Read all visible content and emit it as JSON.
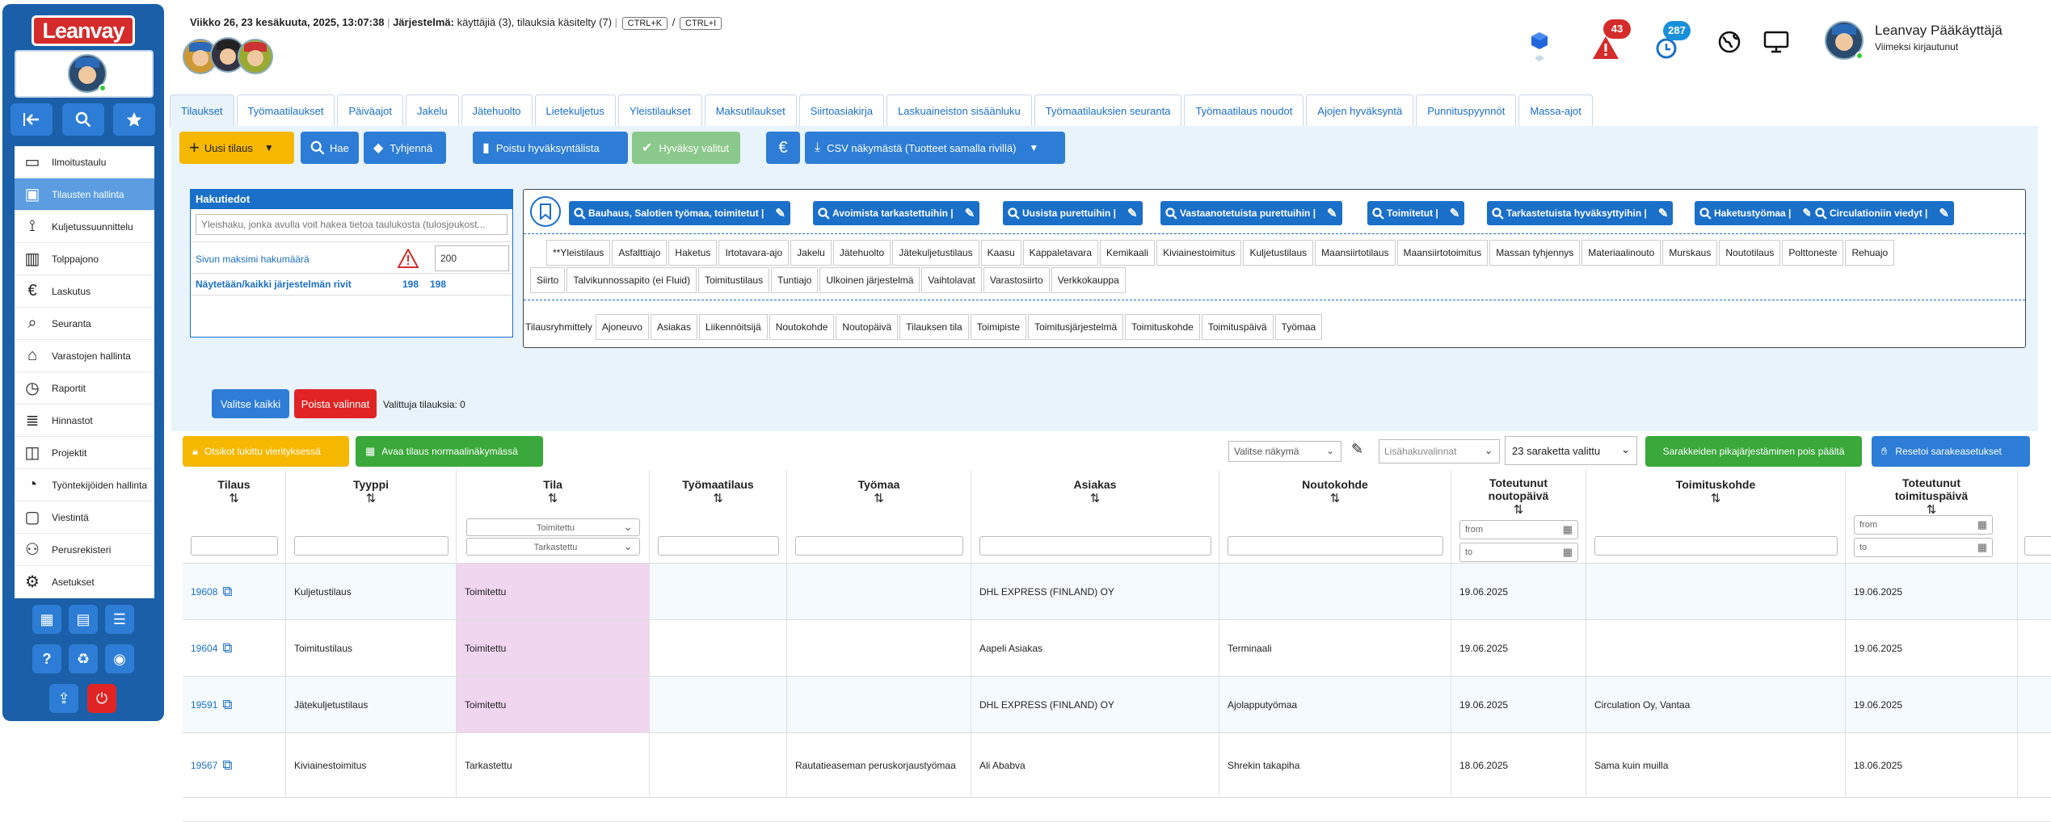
{
  "app": {
    "logo": "Leanvay"
  },
  "header": {
    "date": "Viikko 26, 23 kesäkuuta, 2025, 13:07:38",
    "sys_label": "Järjestelmä:",
    "sys_value": "käyttäjiä (3), tilauksia käsitelty (7)",
    "kbd1": "CTRL+K",
    "sep": "/",
    "kbd2": "CTRL+I",
    "badge_alerts": "43",
    "badge_clock": "287",
    "user_name": "Leanvay Pääkäyttäjä",
    "user_sub": "Viimeksi kirjautunut"
  },
  "sidebar": {
    "items": [
      {
        "label": "Ilmoitustaulu",
        "icon": "board-icon"
      },
      {
        "label": "Tilausten hallinta",
        "icon": "order-icon"
      },
      {
        "label": "Kuljetussuunnittelu",
        "icon": "route-icon"
      },
      {
        "label": "Tolppajono",
        "icon": "queue-icon"
      },
      {
        "label": "Laskutus",
        "icon": "euro-icon"
      },
      {
        "label": "Seuranta",
        "icon": "tracking-icon"
      },
      {
        "label": "Varastojen hallinta",
        "icon": "warehouse-icon"
      },
      {
        "label": "Raportit",
        "icon": "report-icon"
      },
      {
        "label": "Hinnastot",
        "icon": "pricelist-icon"
      },
      {
        "label": "Projektit",
        "icon": "project-icon"
      },
      {
        "label": "Työntekijöiden hallinta",
        "icon": "employee-icon"
      },
      {
        "label": "Viestintä",
        "icon": "chat-icon"
      },
      {
        "label": "Perusrekisteri",
        "icon": "registry-icon"
      },
      {
        "label": "Asetukset",
        "icon": "settings-icon"
      }
    ]
  },
  "tabs": [
    "Tilaukset",
    "Työmaatilaukset",
    "Päiväajot",
    "Jakelu",
    "Jätehuolto",
    "Lietekuljetus",
    "Yleistilaukset",
    "Maksutilaukset",
    "Siirtoasiakirja",
    "Laskuaineiston sisäänluku",
    "Työmaatilauksien seuranta",
    "Työmaatilaus noudot",
    "Ajojen hyväksyntä",
    "Punnituspyynnöt",
    "Massa-ajot"
  ],
  "toolbar": {
    "new": "Uusi tilaus",
    "search": "Hae",
    "clear": "Tyhjennä",
    "remove_approval": "Poistu hyväksyntälista",
    "approve": "Hyväksy valitut",
    "csv": "CSV näkymästä (Tuotteet samalla rivillä)"
  },
  "haku": {
    "title": "Hakutiedot",
    "placeholder": "Yleishaku, jonka avulla voit hakea tietoa taulukosta (tulosjoukost...",
    "max_label": "Sivun maksimi hakumäärä",
    "max_value": "200",
    "rows_label": "Näytetään/kaikki järjestelmän rivit",
    "rows_a": "198",
    "rows_b": "198"
  },
  "quick_searches": [
    "Bauhaus, Salotien työmaa, toimitetut |",
    "Avoimista tarkastettuihin |",
    "Uusista purettuihin |",
    "Vastaanotetuista purettuihin |",
    "Toimitetut |",
    "Tarkastetuista hyväksyttyihin |",
    "Haketustyömaa |",
    "Circulationiin viedyt |"
  ],
  "type_chips_1": [
    "**Yleistilaus",
    "Asfalttiajo",
    "Haketus",
    "Irtotavara-ajo",
    "Jakelu",
    "Jätehuolto",
    "Jätekuljetustilaus",
    "Kaasu",
    "Kappaletavara",
    "Kemikaali",
    "Kiviainestoimitus",
    "Kuljetustilaus",
    "Maansiirtotilaus",
    "Maansiirtotoimitus",
    "Massan tyhjennys",
    "Materiaalinouto",
    "Murskaus",
    "Noutotilaus",
    "Polttoneste",
    "Rehuajo"
  ],
  "type_chips_2": [
    "Siirto",
    "Talvikunnossapito (ei Fluid)",
    "Toimitustilaus",
    "Tuntiajo",
    "Ulkoinen järjestelmä",
    "Vaihtolavat",
    "Varastosiirto",
    "Verkkokauppa"
  ],
  "group_label": "Tilausryhmittely",
  "group_chips": [
    "Ajoneuvo",
    "Asiakas",
    "Liikennöitsijä",
    "Noutokohde",
    "Noutopäivä",
    "Tilauksen tila",
    "Toimipiste",
    "Toimitusjärjestelmä",
    "Toimituskohde",
    "Toimituspäivä",
    "Työmaa"
  ],
  "selection": {
    "select_all": "Valitse kaikki",
    "remove": "Poista valinnat",
    "count": "Valittuja tilauksia: 0"
  },
  "table_toolbar": {
    "locked": "Otsikot lukittu vierityksessä",
    "open_normal": "Avaa tilaus normaalinäkymässä",
    "view": "Valitse näkymä",
    "extra": "Lisähakuvalinnat",
    "columns": "23 saraketta valittu",
    "quicksort": "Sarakkeiden pikajärjestäminen pois päältä",
    "reset": "Resetoi sarakeasetukset"
  },
  "columns": [
    "Tilaus",
    "Tyyppi",
    "Tila",
    "Työmaatilaus",
    "Työmaa",
    "Asiakas",
    "Noutokohde",
    "Toteutunut noutopäivä",
    "Toimituskohde",
    "Toteutunut toimituspäivä"
  ],
  "filters": {
    "tila1": "Toimitettu",
    "tila2": "Tarkastettu",
    "from": "from",
    "to": "to"
  },
  "rows": [
    {
      "id": "19608",
      "type": "Kuljetustilaus",
      "status": "Toimitettu",
      "work_order": "",
      "site": "",
      "customer": "DHL EXPRESS (FINLAND) OY",
      "pickup": "",
      "pickup_date": "19.06.2025",
      "delivery": "",
      "delivery_date": "19.06.2025"
    },
    {
      "id": "19604",
      "type": "Toimitustilaus",
      "status": "Toimitettu",
      "work_order": "",
      "site": "",
      "customer": "Aapeli Asiakas",
      "pickup": "Terminaali",
      "pickup_date": "19.06.2025",
      "delivery": "",
      "delivery_date": "19.06.2025"
    },
    {
      "id": "19591",
      "type": "Jätekuljetustilaus",
      "status": "Toimitettu",
      "work_order": "",
      "site": "",
      "customer": "DHL EXPRESS (FINLAND) OY",
      "pickup": "Ajolapputyömaa",
      "pickup_date": "19.06.2025",
      "delivery": "Circulation Oy, Vantaa",
      "delivery_date": "19.06.2025"
    },
    {
      "id": "19567",
      "type": "Kiviainestoimitus",
      "status": "Tarkastettu",
      "work_order": "",
      "site": "Rautatieaseman peruskorjaustyömaa",
      "customer": "Ali Ababva",
      "pickup": "Shrekin takapiha",
      "pickup_date": "18.06.2025",
      "delivery": "Sama kuin muilla",
      "delivery_date": "18.06.2025"
    }
  ],
  "colors": {
    "sidebar": "#1a5fa8",
    "accent": "#2d7dd6",
    "status_bg": "#f0d6ef",
    "danger": "#e02424",
    "success": "#3aa83a",
    "warning": "#f5b700"
  }
}
